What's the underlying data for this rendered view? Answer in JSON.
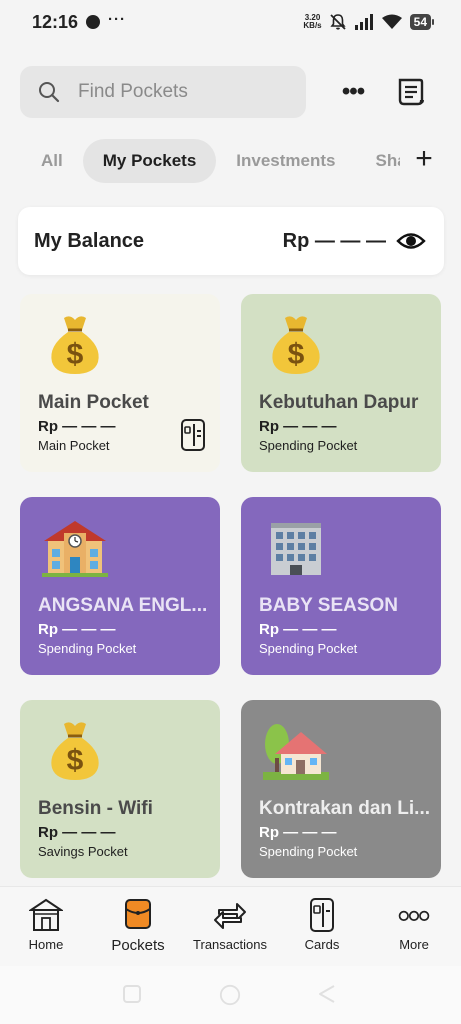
{
  "status_bar": {
    "time": "12:16",
    "dots": "···",
    "net_speed_value": "3.20",
    "net_speed_unit": "KB/s",
    "battery": "54"
  },
  "search": {
    "placeholder": "Find Pockets"
  },
  "tabs": [
    {
      "label": "All",
      "active": false
    },
    {
      "label": "My Pockets",
      "active": true
    },
    {
      "label": "Investments",
      "active": false
    },
    {
      "label": "Shared",
      "active": false
    }
  ],
  "add_tab_symbol": "+",
  "more_symbol": "•••",
  "balance": {
    "title": "My Balance",
    "value": "Rp — — —"
  },
  "pockets": [
    {
      "name": "Main Pocket",
      "amount": "Rp — — —",
      "type": "Main Pocket",
      "icon": "money-bag-icon",
      "color": "#f5f4ec"
    },
    {
      "name": "Kebutuhan Dapur",
      "amount": "Rp — — —",
      "type": "Spending Pocket",
      "icon": "money-bag-icon",
      "color": "#d3e0c4"
    },
    {
      "name": "ANGSANA ENGL...",
      "amount": "Rp — — —",
      "type": "Spending Pocket",
      "icon": "school-icon",
      "color": "#8468bd"
    },
    {
      "name": "BABY SEASON",
      "amount": "Rp — — —",
      "type": "Spending Pocket",
      "icon": "office-building-icon",
      "color": "#8468bd"
    },
    {
      "name": "Bensin - Wifi",
      "amount": "Rp — — —",
      "type": "Savings Pocket",
      "icon": "money-bag-icon",
      "color": "#d3e0c4"
    },
    {
      "name": "Kontrakan dan Li...",
      "amount": "Rp — — —",
      "type": "Spending Pocket",
      "icon": "house-with-garden-icon",
      "color": "#8a8a8a"
    }
  ],
  "bottom_nav": [
    {
      "label": "Home",
      "icon": "home-icon"
    },
    {
      "label": "Pockets",
      "icon": "pocket-wallet-icon",
      "active": true
    },
    {
      "label": "Transactions",
      "icon": "transfer-arrows-icon"
    },
    {
      "label": "Cards",
      "icon": "card-icon"
    },
    {
      "label": "More",
      "icon": "more-circles-icon"
    }
  ]
}
